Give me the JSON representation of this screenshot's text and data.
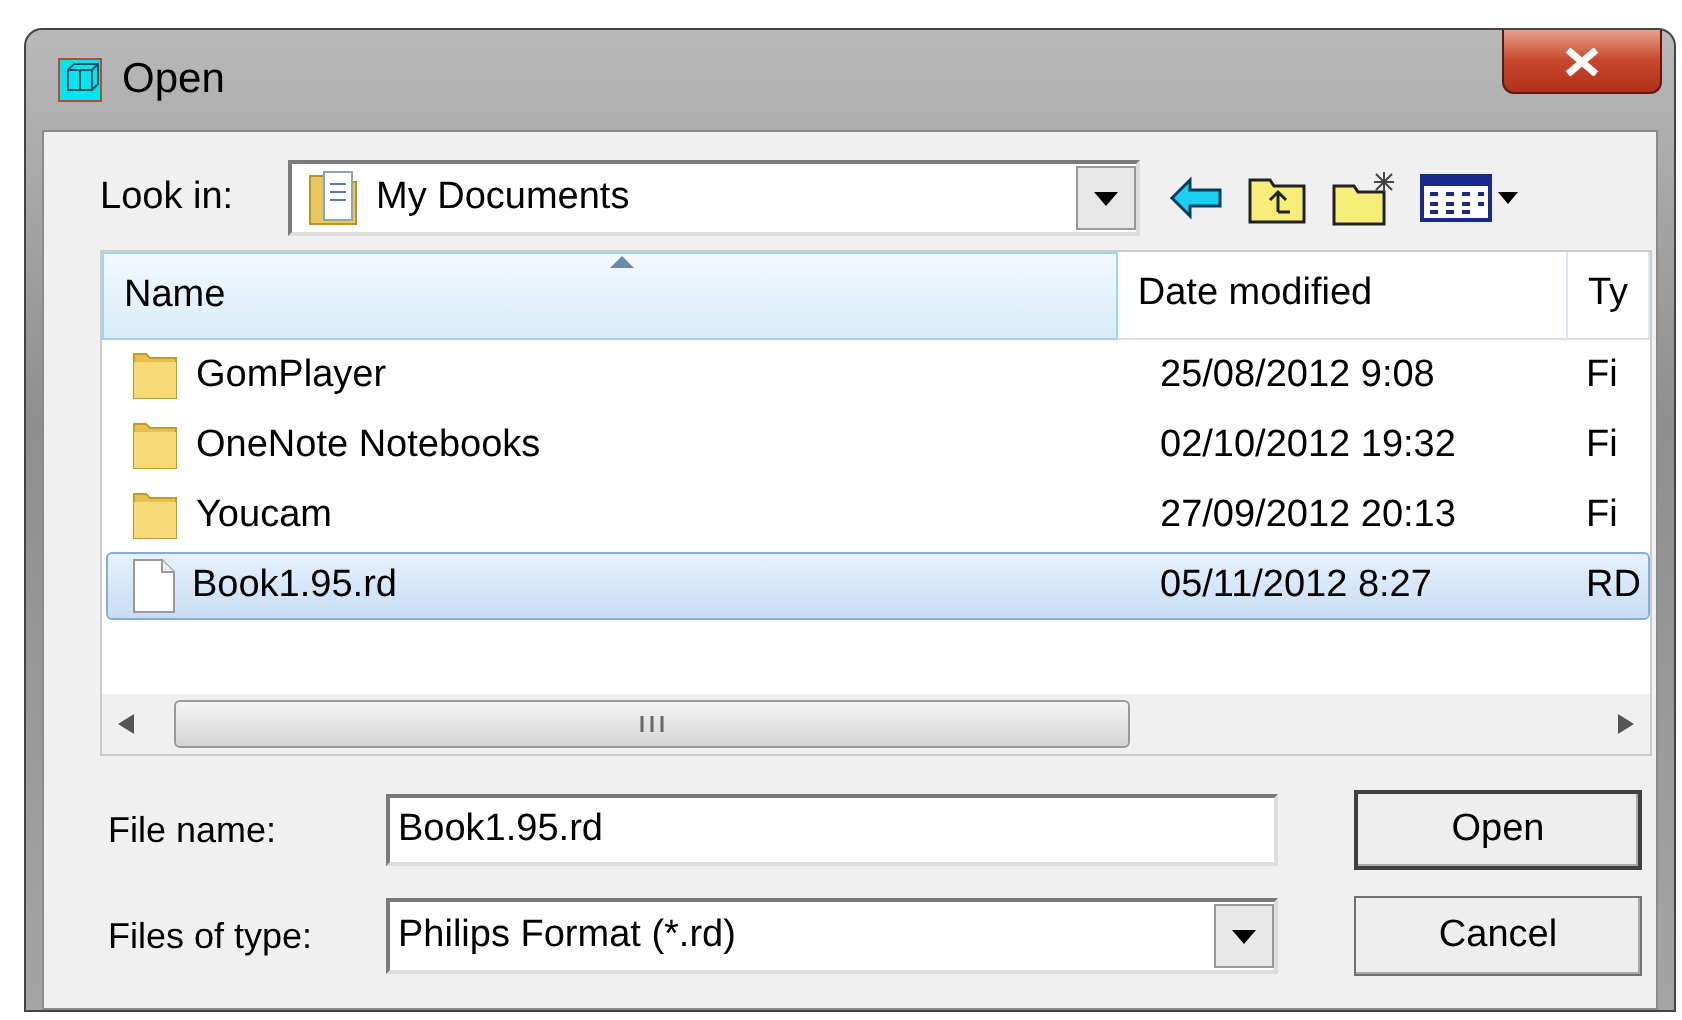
{
  "window": {
    "title": "Open"
  },
  "look_in": {
    "label": "Look in:",
    "value": "My Documents"
  },
  "file_list": {
    "columns": [
      {
        "label": "Name",
        "sorted": true
      },
      {
        "label": "Date modified",
        "sorted": false
      },
      {
        "label": "Ty",
        "sorted": false
      }
    ],
    "rows": [
      {
        "kind": "folder",
        "name": "GomPlayer",
        "date": "25/08/2012 9:08",
        "column_3": "Fi",
        "selected": false
      },
      {
        "kind": "folder",
        "name": "OneNote Notebooks",
        "date": "02/10/2012 19:32",
        "column_3": "Fi",
        "selected": false
      },
      {
        "kind": "folder",
        "name": "Youcam",
        "date": "27/09/2012 20:13",
        "column_3": "Fi",
        "selected": false
      },
      {
        "kind": "file",
        "name": "Book1.95.rd",
        "date": "05/11/2012 8:27",
        "column_3": "RD",
        "selected": true
      }
    ]
  },
  "file_name": {
    "label": "File name:",
    "value": "Book1.95.rd"
  },
  "file_type": {
    "label": "Files of type:",
    "value": "Philips Format (*.rd)"
  },
  "buttons": [
    {
      "label": "Open",
      "default": true
    },
    {
      "label": "Cancel",
      "default": false
    }
  ]
}
